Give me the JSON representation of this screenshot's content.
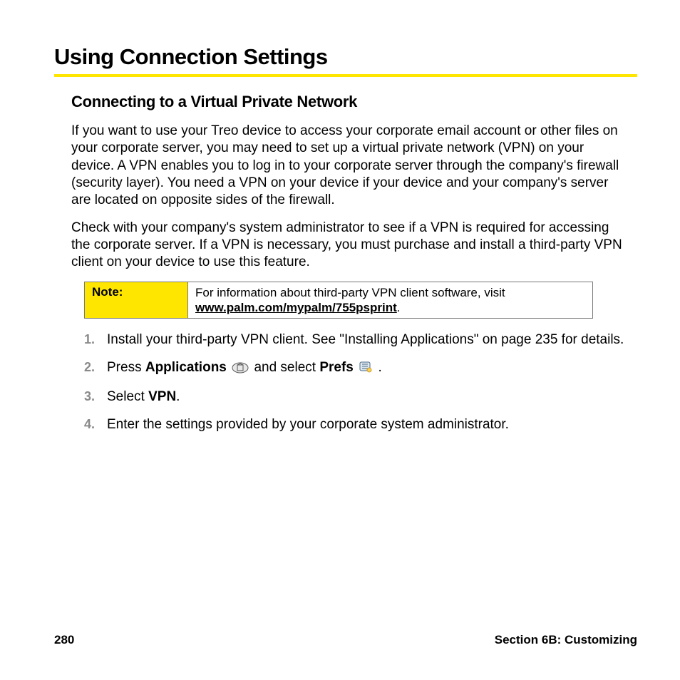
{
  "title": "Using Connection Settings",
  "subheading": "Connecting to a Virtual Private Network",
  "para1": "If you want to use your Treo device to access your corporate email account or other files on your corporate server, you may need to set up a virtual private network (VPN) on your device. A VPN enables you to log in to your corporate server through the company's firewall (security layer). You need a VPN on your device if your device and your company's server are located on opposite sides of the firewall.",
  "para2": "Check with your company's system administrator to see if a VPN is required for accessing the corporate server. If a VPN is necessary, you must purchase and install a third-party VPN client on your device to use this feature.",
  "note": {
    "label": "Note:",
    "text_prefix": "For information about third-party VPN client software, visit ",
    "link": "www.palm.com/mypalm/755psprint",
    "text_suffix": "."
  },
  "steps": {
    "s1": "Install your third-party VPN client. See \"Installing Applications\" on page 235 for details.",
    "s2_a": "Press ",
    "s2_b": "Applications",
    "s2_c": " and select ",
    "s2_d": "Prefs",
    "s2_e": " .",
    "s3_a": "Select ",
    "s3_b": "VPN",
    "s3_c": ".",
    "s4": "Enter the settings provided by your corporate system administrator."
  },
  "footer": {
    "page_number": "280",
    "section": "Section 6B: Customizing"
  }
}
